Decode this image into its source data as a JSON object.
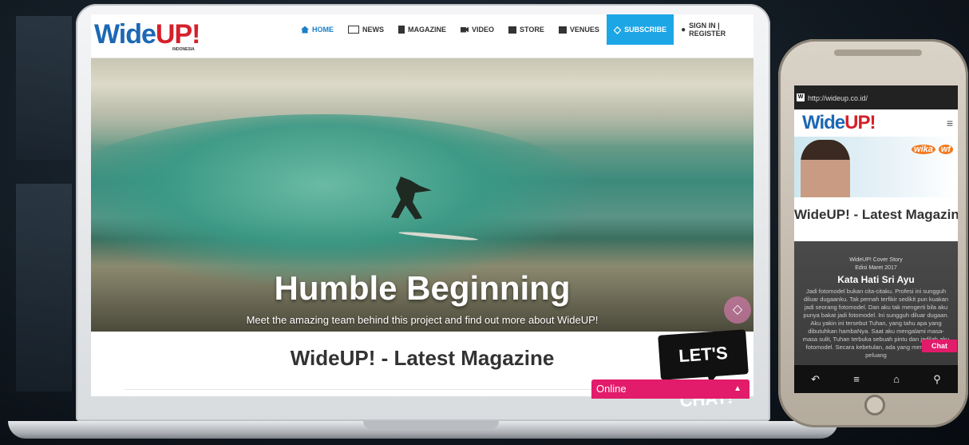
{
  "site": {
    "logo_main": "Wide",
    "logo_up": "UP!",
    "logo_sub": "INDONESIA"
  },
  "nav": {
    "items": [
      {
        "label": "HOME",
        "icon": "home-icon"
      },
      {
        "label": "NEWS",
        "icon": "newspaper-icon"
      },
      {
        "label": "MAGAZINE",
        "icon": "book-icon"
      },
      {
        "label": "VIDEO",
        "icon": "video-icon"
      },
      {
        "label": "STORE",
        "icon": "store-icon"
      },
      {
        "label": "VENUES",
        "icon": "venue-icon"
      },
      {
        "label": "SUBSCRIBE",
        "icon": "diamond-icon"
      },
      {
        "label": "SIGN IN | REGISTER",
        "icon": "user-icon"
      }
    ]
  },
  "hero": {
    "title": "Humble Beginning",
    "subtitle": "Meet the amazing team behind this project and find out more about WideUP!"
  },
  "section": {
    "title": "WideUP! - Latest Magazine"
  },
  "chat": {
    "bubble": "LET'S CHAT!",
    "status": "Online"
  },
  "phone": {
    "url": "http://wideup.co.id/",
    "favicon": "W",
    "ad_brand": "wika",
    "ad_brand_suffix": "wf",
    "latest": "WideUP! - Latest Magazine",
    "cover_tag": "WideUP! Cover Story",
    "cover_edition": "Edisi Maret 2017",
    "cover_title": "Kata Hati Sri Ayu",
    "cover_text": "Jadi fotomodel bukan cita-citaku. Profesi ini sungguh diluar dugaanku. Tak pernah terfikir sedikit pun kuakan jadi seorang fotomodel. Dan aku tak mengerti bila aku punya bakat jadi fotomodel. Ini sungguh diluar dugaan. Aku yakin ini tersebut Tuhan, yang tahu apa yang dibutuhkan hambaNya. Saat aku mengalami masa-masa sulit, Tuhan terbuka sebuah pintu dan jadilah aku fotomodel. Secara kebetulan, ada yang memberi aku peluang",
    "chat_label": "Chat"
  }
}
